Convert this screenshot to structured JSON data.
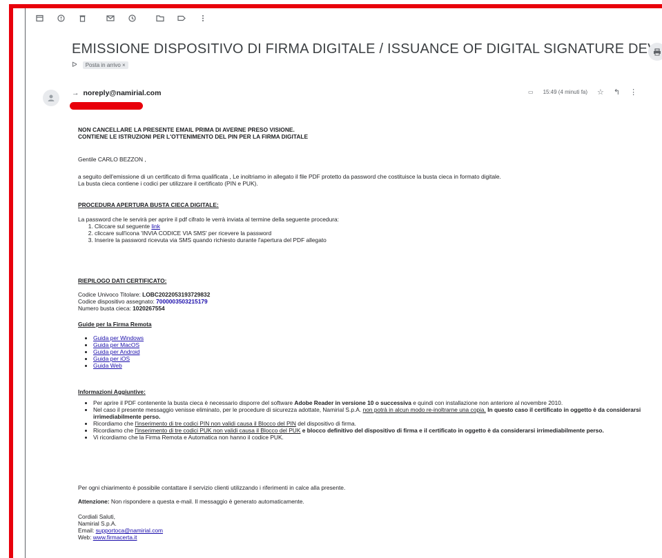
{
  "toolbar": {
    "icons": [
      "archive-icon",
      "report-spam-icon",
      "delete-icon",
      "mark-unread-icon",
      "snooze-icon",
      "move-to-icon",
      "label-icon",
      "more-vert-icon"
    ]
  },
  "subject": "EMISSIONE DISPOSITIVO DI FIRMA DIGITALE / ISSUANCE OF DIGITAL SIGNATURE DEVICE",
  "label": "Posta in arrivo ×",
  "sender": {
    "email": "noreply@namirial.com"
  },
  "meta": {
    "time": "15:49 (4 minuti fa)"
  },
  "body": {
    "warning1": "NON CANCELLARE LA PRESENTE EMAIL PRIMA DI AVERNE PRESO VISIONE.",
    "warning2": "CONTIENE LE ISTRUZIONI PER L'OTTENIMENTO DEL PIN PER LA FIRMA DIGITALE",
    "greeting": "Gentile CARLO BEZZON ,",
    "intro1": "a seguito dell'emissione di un certificato di firma qualificata , Le inoltriamo in allegato il file PDF protetto da password che costituisce la busta cieca in formato digitale.",
    "intro2": "La busta cieca contiene i codici per utilizzare il certificato (PIN e PUK).",
    "procedure_title": "PROCEDURA APERTURA BUSTA CIECA DIGITALE:",
    "procedure_intro": "La password che le servirà per aprire il pdf cifrato le verrà inviata al termine della seguente procedura:",
    "step1": "Cliccare sul seguente ",
    "step1_link": "link",
    "step2": "cliccare sull'icona 'INVIA CODICE VIA SMS' per ricevere la password",
    "step3": "Inserire la password ricevuta via SMS quando richiesto durante l'apertura del PDF allegato",
    "summary_title": "RIEPILOGO DATI CERTIFICATO:",
    "code_label": "Codice Univoco Titolare: ",
    "code_value": "LOBC2022053193729832",
    "device_label": "Codice dispositivo assegnato: ",
    "device_value": "7000003503215179",
    "envelope_label": "Numero busta cieca: ",
    "envelope_value": "1020267554",
    "guides_title": "Guide per la Firma Remota",
    "guides": [
      "Guida per Windows",
      "Guida per MacOS",
      "Guida per Android",
      "Guida per iOS",
      "Guida Web"
    ],
    "info_title": "Informazioni Aggiuntive:",
    "info1a": "Per aprire il PDF contenente la busta cieca è necessario disporre del software ",
    "info1b": "Adobe Reader in versione 10 o successiva",
    "info1c": " e quindi con installazione non anteriore al novembre 2010.",
    "info2a": "Nel caso il presente messaggio venisse eliminato, per le procedure di sicurezza adottate, Namirial S.p.A. ",
    "info2b": "non potrà in alcun modo re-inoltrarne una copia.",
    "info2c": " In questo caso il certificato in oggetto è da considerarsi irrimediabilmente perso.",
    "info3a": "Ricordiamo che ",
    "info3b": "l'inserimento di tre codici PIN non validi causa il Blocco del PIN",
    "info3c": " del dispositivo di firma.",
    "info4a": "Ricordiamo che ",
    "info4b": "l'inserimento di tre codici PUK non validi causa il Blocco del PUK",
    "info4c": " e blocco definitivo del dispositivo di firma e il certificato in oggetto è da considerarsi irrimediabilmente perso.",
    "info5": "Vi ricordiamo che la Firma Remota e Automatica non hanno il codice PUK.",
    "contact": "Per ogni chiarimento è possibile contattare il servizio clienti utilizzando i riferimenti in calce alla presente.",
    "attention_label": "Attenzione:",
    "attention_text": " Non rispondere a questa e-mail. Il messaggio è generato automaticamente.",
    "closing": "Cordiali Saluti,",
    "company": "Namirial S.p.A.",
    "email_label": "Email: ",
    "email_value": "supportoca@namirial.com",
    "web_label": "Web: ",
    "web_value": "www.firmacerta.it"
  },
  "colors": {
    "frame": "#e8000b",
    "link": "#1a0dab"
  }
}
